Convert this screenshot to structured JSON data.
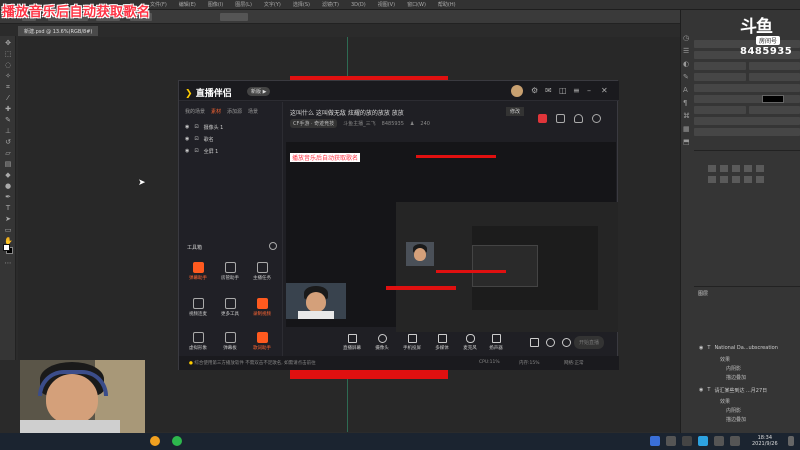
{
  "overlay": {
    "title": "播放音乐后自动获取歌名"
  },
  "room_logo": {
    "mark": "斗鱼",
    "label": "房间号",
    "number": "8485935"
  },
  "photoshop": {
    "menu": [
      "文件(F)",
      "编辑(E)",
      "图像(I)",
      "图层(L)",
      "文字(Y)",
      "选择(S)",
      "滤镜(T)",
      "3D(D)",
      "视图(V)",
      "窗口(W)",
      "帮助(H)"
    ],
    "tab": "新建.psd @ 13.6%(RGB/8#)",
    "layers_tab": "图层",
    "layers": [
      {
        "name": "National Da...ubscreation",
        "subs": [
          "效果",
          "内阴影",
          "描边叠加"
        ]
      },
      {
        "name": "请汇某些到达 ...月27日",
        "subs": [
          "效果",
          "内阴影",
          "描边叠加"
        ]
      }
    ]
  },
  "companion": {
    "app_name": "直播伴侣",
    "badge": "新版 ▶",
    "left_tabs": [
      "我的场景",
      "素材",
      "添加源",
      "场景"
    ],
    "scenes": [
      "摄像头 1",
      "歌名",
      "全屏 1"
    ],
    "tools_label": "工具箱",
    "tools": [
      {
        "label": "弹幕助手",
        "color": "orange"
      },
      {
        "label": "房管助手",
        "color": "grey"
      },
      {
        "label": "主播任务",
        "color": "grey"
      },
      {
        "label": "视频连麦",
        "color": "grey"
      },
      {
        "label": "更多工具",
        "color": "grey"
      },
      {
        "label": "录制视频",
        "color": "orange"
      },
      {
        "label": "虚拟形象",
        "color": "grey"
      },
      {
        "label": "弹幕板",
        "color": "grey"
      },
      {
        "label": "歌词助手",
        "color": "orange"
      }
    ],
    "room_title": "这叫什么 这叫做无敌 炫耀的放的放放 放放",
    "room_button": "修改",
    "room_meta": {
      "category": "CF手游 · 奇迹竞技",
      "host": "斗鱼主播_三飞",
      "room": "8485935",
      "viewers": "240"
    },
    "preview_title": "播放音乐后自动获取歌名",
    "bottom_items": [
      "直播屏幕",
      "摄像头",
      "手机投屏",
      "多媒体",
      "麦克风",
      "扬声器"
    ],
    "start_button": "开始直播",
    "status_text": "综合使用第三方播放软件 不需双击不足歌名, 如需请点击前往",
    "status_right": [
      "CPU:11%",
      "内存:15%",
      "网络:正常"
    ]
  },
  "taskbar": {
    "time": "18:34",
    "date": "2021/9/26"
  },
  "colors": {
    "accent": "#ff5a1f",
    "overlay_title": "#ff3344",
    "stream_bar": "#e01010"
  }
}
